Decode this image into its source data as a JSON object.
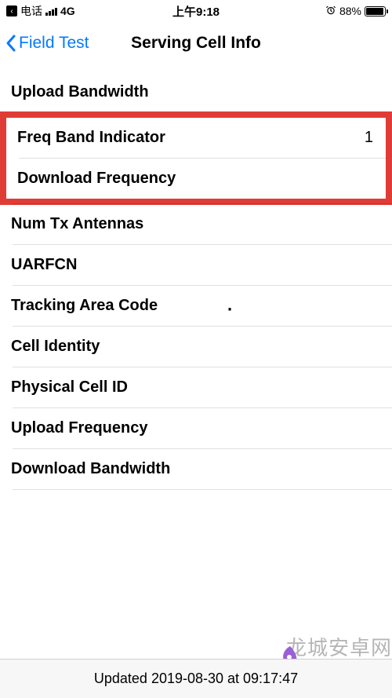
{
  "status_bar": {
    "back_app": "‹",
    "carrier": "电话",
    "network": "4G",
    "time": "上午9:18",
    "battery_percent": "88%"
  },
  "nav": {
    "back_label": "Field Test",
    "title": "Serving Cell Info"
  },
  "rows": [
    {
      "label": "Upload Bandwidth",
      "value": ""
    },
    {
      "label": "Freq Band Indicator",
      "value": "1"
    },
    {
      "label": "Download Frequency",
      "value": ""
    },
    {
      "label": "Num Tx Antennas",
      "value": ""
    },
    {
      "label": "UARFCN",
      "value": ""
    },
    {
      "label": "Tracking Area Code",
      "value": ""
    },
    {
      "label": "Cell Identity",
      "value": ""
    },
    {
      "label": "Physical Cell ID",
      "value": ""
    },
    {
      "label": "Upload Frequency",
      "value": ""
    },
    {
      "label": "Download Bandwidth",
      "value": ""
    }
  ],
  "footer": {
    "updated": "Updated 2019-08-30 at 09:17:47"
  },
  "watermark": {
    "text": "龙城安卓网",
    "url": "www.lcjrfg.com"
  },
  "highlight_color": "#e03c36"
}
